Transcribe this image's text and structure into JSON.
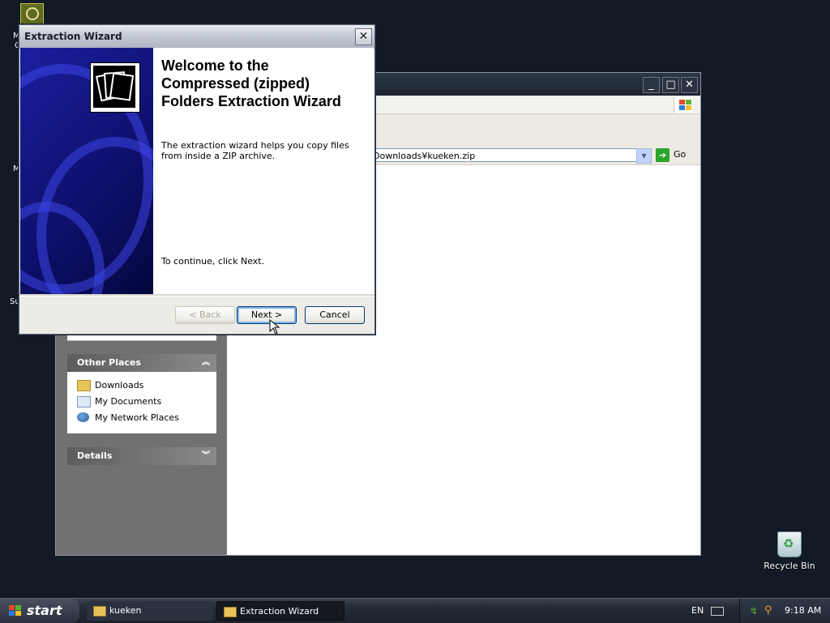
{
  "desktop": {
    "fragments": [
      "M",
      "C",
      "M",
      "Su"
    ],
    "recycle_bin": "Recycle Bin"
  },
  "explorer": {
    "address": "$Downloads¥kueken.zip",
    "go_label": "Go",
    "other_places": {
      "title": "Other Places",
      "items": [
        "Downloads",
        "My Documents",
        "My Network Places"
      ]
    },
    "details": {
      "title": "Details"
    }
  },
  "wizard": {
    "title": "Extraction Wizard",
    "heading": "Welcome to the Compressed (zipped) Folders Extraction Wizard",
    "description": "The extraction wizard helps you copy files\nfrom inside a ZIP archive.",
    "continue_text": "To continue, click Next.",
    "back_label": "< Back",
    "next_label": "Next >",
    "cancel_label": "Cancel"
  },
  "taskbar": {
    "start_label": "start",
    "tasks": [
      "kueken",
      "Extraction Wizard"
    ],
    "language": "EN",
    "time": "9:18 AM"
  },
  "colors": {
    "desktop": "#121a25",
    "banner": "#1b1f9e",
    "pane": "#717171"
  }
}
